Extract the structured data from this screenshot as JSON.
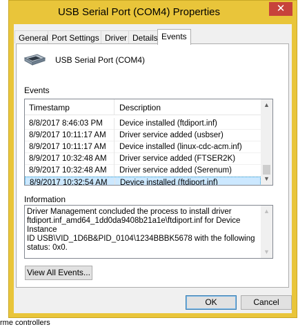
{
  "window": {
    "title": "USB Serial Port (COM4) Properties",
    "close_glyph": "✕"
  },
  "tabs": [
    {
      "label": "General"
    },
    {
      "label": "Port Settings"
    },
    {
      "label": "Driver"
    },
    {
      "label": "Details"
    },
    {
      "label": "Events",
      "active": true
    }
  ],
  "device": {
    "name": "USB Serial Port (COM4)",
    "icon": "usb-connector-icon"
  },
  "events": {
    "label": "Events",
    "columns": {
      "timestamp": "Timestamp",
      "description": "Description"
    },
    "rows": [
      {
        "timestamp": "8/8/2017 8:46:03 PM",
        "description": "Device installed (ftdiport.inf)"
      },
      {
        "timestamp": "8/9/2017 10:11:17 AM",
        "description": "Driver service added (usbser)"
      },
      {
        "timestamp": "8/9/2017 10:11:17 AM",
        "description": "Device installed (linux-cdc-acm.inf)"
      },
      {
        "timestamp": "8/9/2017 10:32:48 AM",
        "description": "Driver service added (FTSER2K)"
      },
      {
        "timestamp": "8/9/2017 10:32:48 AM",
        "description": "Driver service added (Serenum)"
      },
      {
        "timestamp": "8/9/2017 10:32:54 AM",
        "description": "Device installed (ftdiport.inf)",
        "selected": true
      }
    ]
  },
  "information": {
    "label": "Information",
    "text": "Driver Management concluded the process to install driver\nftdiport.inf_amd64_1dd0da9408b21a1e\\ftdiport.inf for Device Instance\nID USB\\VID_1D6B&PID_0104\\1234BBBK5678 with the following\nstatus: 0x0."
  },
  "buttons": {
    "view_all": "View All Events...",
    "ok": "OK",
    "cancel": "Cancel"
  },
  "background": {
    "bottom_text": "rme controllers"
  },
  "colors": {
    "title_bar": "#e9c53a",
    "close_button": "#c7433b",
    "selection": "#cce8ff"
  }
}
